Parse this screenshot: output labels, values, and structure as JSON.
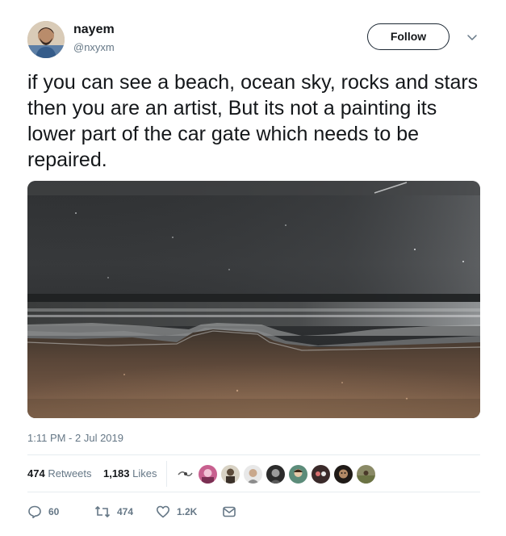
{
  "author": {
    "name": "nayem",
    "handle": "@nxyxm"
  },
  "follow_label": "Follow",
  "tweet_text": "if you can see a beach, ocean sky, rocks and stars then you are an artist, But its not a painting its lower part of the car gate which needs to be repaired.",
  "timestamp": "1:11 PM - 2 Jul 2019",
  "stats": {
    "retweets_count": "474",
    "retweets_label": "Retweets",
    "likes_count": "1,183",
    "likes_label": "Likes"
  },
  "actions": {
    "replies": "60",
    "retweets": "474",
    "likes": "1.2K"
  },
  "icons": {
    "caret": "chevron-down-icon",
    "reply": "reply-icon",
    "retweet": "retweet-icon",
    "like": "heart-icon",
    "dm": "message-icon"
  },
  "colors": {
    "text": "#14171a",
    "secondary": "#657786",
    "divider": "#e6ecf0"
  }
}
